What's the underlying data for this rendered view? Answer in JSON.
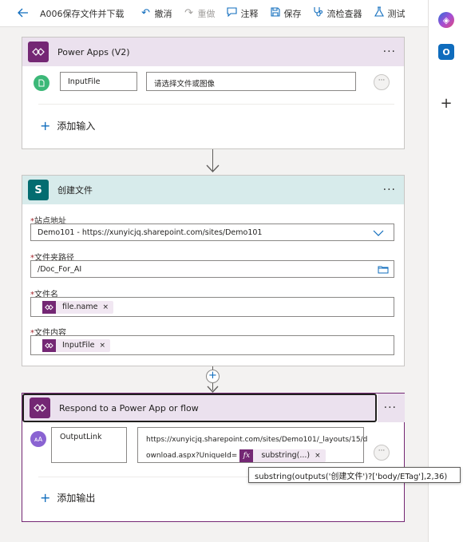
{
  "toolbar": {
    "title": "A006保存文件并下载",
    "undo": "撤消",
    "redo": "重做",
    "comment": "注释",
    "save": "保存",
    "flow_checker": "流检查器",
    "test": "测试"
  },
  "power_apps_card": {
    "title": "Power Apps (V2)",
    "input_name": "InputFile",
    "input_description": "请选择文件或图像",
    "add_input": "添加输入"
  },
  "create_file_card": {
    "title": "创建文件",
    "site_label": "站点地址",
    "site_value": "Demo101 - https://xunyicjq.sharepoint.com/sites/Demo101",
    "folder_label": "文件夹路径",
    "folder_value": "/Doc_For_AI",
    "filename_label": "文件名",
    "filename_token": "file.name",
    "content_label": "文件内容",
    "content_token": "InputFile"
  },
  "respond_card": {
    "title": "Respond to a Power App or flow",
    "output_name": "OutputLink",
    "output_value_line1": "https://xunyicjq.sharepoint.com/sites/Demo101/_layouts/15/d",
    "output_value_line2": "ownload.aspx?UniqueId=",
    "expr_token": "substring(...)",
    "add_output": "添加输出"
  },
  "tooltip": "substring(outputs('创建文件')?['body/ETag'],2,36)",
  "colors": {
    "accent": "#0f6cbd",
    "power_apps": "#742774",
    "sharepoint": "#036c70"
  }
}
